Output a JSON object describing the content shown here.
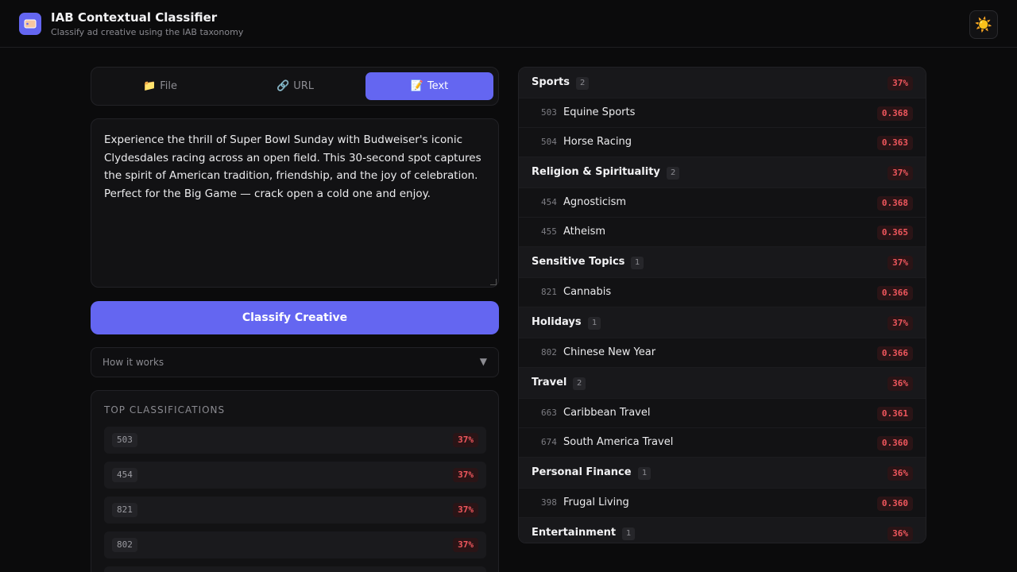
{
  "header": {
    "title": "IAB Contextual Classifier",
    "subtitle": "Classify ad creative using the IAB taxonomy",
    "theme_icon": "☀️"
  },
  "tabs": [
    {
      "icon": "📁",
      "label": "File",
      "active": false
    },
    {
      "icon": "🔗",
      "label": "URL",
      "active": false
    },
    {
      "icon": "📝",
      "label": "Text",
      "active": true
    }
  ],
  "input_text": "Experience the thrill of Super Bowl Sunday with Budweiser's iconic Clydesdales racing across an open field. This 30-second spot captures the spirit of American tradition, friendship, and the joy of celebration. Perfect for the Big Game — crack open a cold one and enjoy.",
  "classify_button": "Classify Creative",
  "how_it_works": {
    "label": "How it works",
    "caret": "▼"
  },
  "top_classifications": {
    "title": "TOP CLASSIFICATIONS",
    "rows": [
      {
        "code": "503",
        "pct": "37%"
      },
      {
        "code": "454",
        "pct": "37%"
      },
      {
        "code": "821",
        "pct": "37%"
      },
      {
        "code": "802",
        "pct": "37%"
      },
      {
        "code": "",
        "pct": ""
      }
    ]
  },
  "results": [
    {
      "type": "group",
      "name": "Sports",
      "count": "2",
      "pct": "37%"
    },
    {
      "type": "item",
      "code": "503",
      "name": "Equine Sports",
      "score": "0.368"
    },
    {
      "type": "item",
      "code": "504",
      "name": "Horse Racing",
      "score": "0.363"
    },
    {
      "type": "group",
      "name": "Religion & Spirituality",
      "count": "2",
      "pct": "37%"
    },
    {
      "type": "item",
      "code": "454",
      "name": "Agnosticism",
      "score": "0.368"
    },
    {
      "type": "item",
      "code": "455",
      "name": "Atheism",
      "score": "0.365"
    },
    {
      "type": "group",
      "name": "Sensitive Topics",
      "count": "1",
      "pct": "37%"
    },
    {
      "type": "item",
      "code": "821",
      "name": "Cannabis",
      "score": "0.366"
    },
    {
      "type": "group",
      "name": "Holidays",
      "count": "1",
      "pct": "37%"
    },
    {
      "type": "item",
      "code": "802",
      "name": "Chinese New Year",
      "score": "0.366"
    },
    {
      "type": "group",
      "name": "Travel",
      "count": "2",
      "pct": "36%"
    },
    {
      "type": "item",
      "code": "663",
      "name": "Caribbean Travel",
      "score": "0.361"
    },
    {
      "type": "item",
      "code": "674",
      "name": "South America Travel",
      "score": "0.360"
    },
    {
      "type": "group",
      "name": "Personal Finance",
      "count": "1",
      "pct": "36%"
    },
    {
      "type": "item",
      "code": "398",
      "name": "Frugal Living",
      "score": "0.360"
    },
    {
      "type": "group",
      "name": "Entertainment",
      "count": "1",
      "pct": "36%"
    }
  ],
  "colors": {
    "accent": "#6466f1",
    "danger": "#f0575d"
  }
}
